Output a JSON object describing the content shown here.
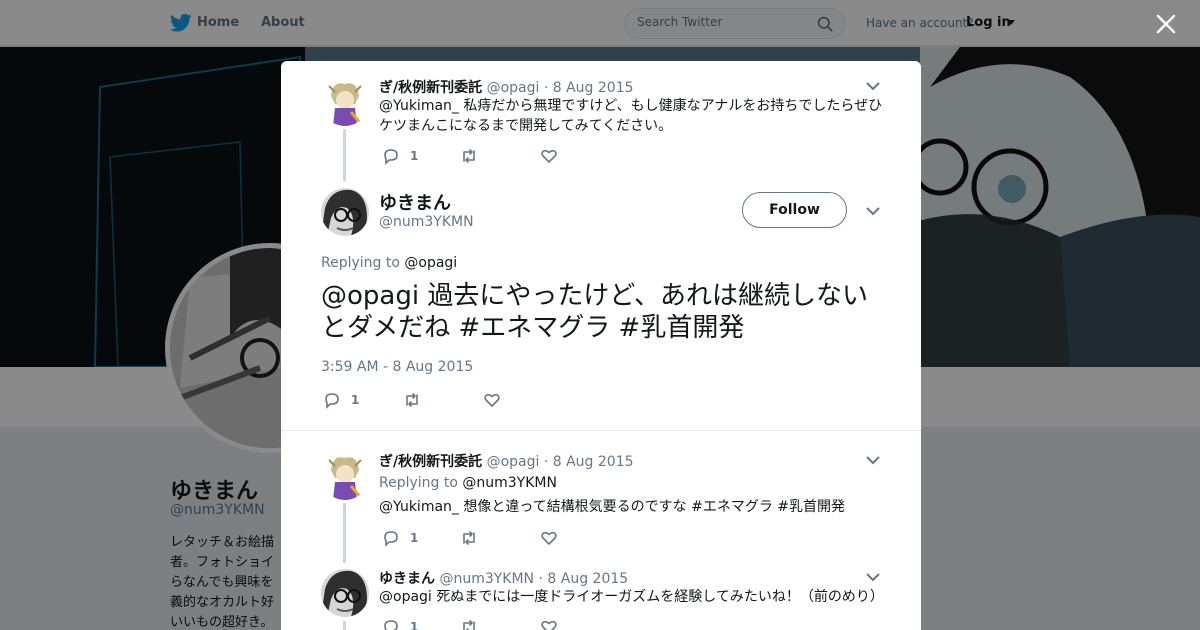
{
  "nav": {
    "home_label": "Home",
    "about_label": "About",
    "search_placeholder": "Search Twitter",
    "account_question": "Have an account?",
    "login_label": "Log in"
  },
  "profile": {
    "name": "ゆきまん",
    "handle": "@num3YKMN",
    "bio_lines": [
      "レタッチ＆お絵描",
      "者。フォトショイ",
      "らなんでも興味を",
      "義的なオカルト好",
      "いいもの超好き。"
    ]
  },
  "colors": {
    "brand_blue": "#1da1f2",
    "overlay": "rgba(0,0,0,0.46)"
  },
  "tweets": {
    "t1": {
      "name": "ぎ/秋例新刊委託",
      "handle": "@opagi",
      "sep": "·",
      "date": "8 Aug 2015",
      "text": "@Yukiman_ 私痔だから無理ですけど、もし健康なアナルをお持ちでしたらぜひケツまんこになるまで開発してみてください。",
      "reply_count": "1"
    },
    "main": {
      "name": "ゆきまん",
      "handle": "@num3YKMN",
      "follow_label": "Follow",
      "replying_prefix": "Replying to",
      "replying_to": "@opagi",
      "text": "@opagi 過去にやったけど、あれは継続しないとダメだね #エネマグラ #乳首開発",
      "timestamp": "3:59 AM - 8 Aug 2015",
      "reply_count": "1"
    },
    "t3": {
      "name": "ぎ/秋例新刊委託",
      "handle": "@opagi",
      "sep": "·",
      "date": "8 Aug 2015",
      "replying_prefix": "Replying to",
      "replying_to": "@num3YKMN",
      "text": "@Yukiman_ 想像と違って結構根気要るのですな #エネマグラ #乳首開発",
      "reply_count": "1"
    },
    "t4": {
      "name": "ゆきまん",
      "handle": "@num3YKMN",
      "sep": "·",
      "date": "8 Aug 2015",
      "text": "@opagi 死ぬまでには一度ドライオーガズムを経験してみたいね！（前のめり）",
      "reply_count": "1"
    }
  }
}
